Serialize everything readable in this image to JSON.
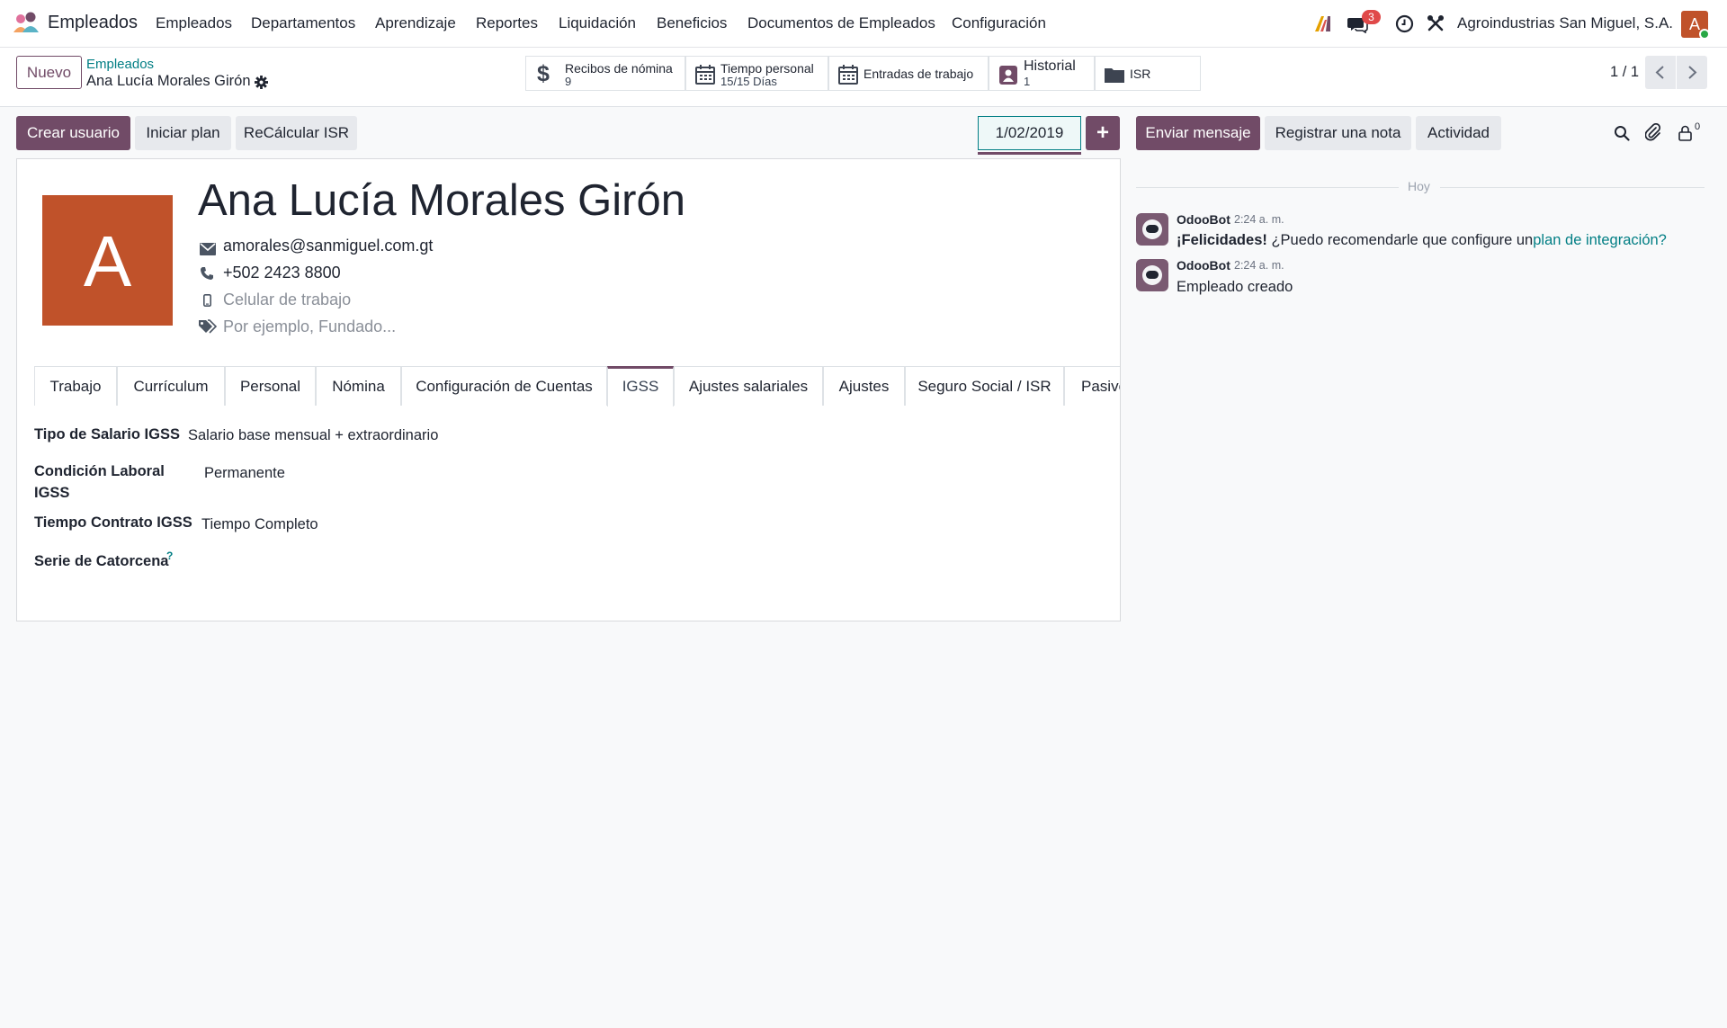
{
  "navbar": {
    "app_name": "Empleados",
    "menu": [
      "Empleados",
      "Departamentos",
      "Aprendizaje",
      "Reportes",
      "Liquidación",
      "Beneficios",
      "Documentos de Empleados",
      "Configuración"
    ],
    "messages_count": "3",
    "company": "Agroindustrias San Miguel, S.A.",
    "user_initial": "A"
  },
  "controlbar": {
    "new_button": "Nuevo",
    "breadcrumb_parent": "Empleados",
    "breadcrumb_current": "Ana Lucía Morales Girón",
    "pager": "1 / 1",
    "stats": [
      {
        "label": "Recibos de nómina",
        "value": "9"
      },
      {
        "label": "Tiempo personal",
        "value": "15/15 Días"
      },
      {
        "label": "Entradas de trabajo",
        "value": ""
      },
      {
        "label": "Historial",
        "value": "1"
      },
      {
        "label": "ISR",
        "value": ""
      }
    ]
  },
  "actions": {
    "create_user": "Crear usuario",
    "start_plan": "Iniciar plan",
    "recalc_isr": "ReCálcular ISR",
    "date": "1/02/2019",
    "add": "+"
  },
  "employee": {
    "avatar_letter": "A",
    "avatar_color": "#c0522a",
    "name": "Ana Lucía Morales Girón",
    "email": "amorales@sanmiguel.com.gt",
    "phone": "+502 2423 8800",
    "mobile_placeholder": "Celular de trabajo",
    "tags_placeholder": "Por ejemplo, Fundado..."
  },
  "tabs": [
    "Trabajo",
    "Currículum",
    "Personal",
    "Nómina",
    "Configuración de Cuentas",
    "IGSS",
    "Ajustes salariales",
    "Ajustes",
    "Seguro Social / ISR",
    "Pasivo"
  ],
  "active_tab": "IGSS",
  "igss": {
    "salary_type_label": "Tipo de Salario IGSS",
    "salary_type_value": "Salario base mensual + extraordinario",
    "labor_condition_label_1": "Condición Laboral",
    "labor_condition_label_2": "IGSS",
    "labor_condition_value": "Permanente",
    "contract_time_label": "Tiempo Contrato IGSS",
    "contract_time_value": "Tiempo Completo",
    "fortnight_series_label": "Serie de Catorcena",
    "help_mark": "?"
  },
  "chatter": {
    "send_message": "Enviar mensaje",
    "log_note": "Registrar una nota",
    "activity": "Actividad",
    "followers_count": "0",
    "date_separator": "Hoy",
    "messages": [
      {
        "author": "OdooBot",
        "time": "2:24 a. m.",
        "bold": "¡Felicidades!",
        "text": " ¿Puedo recomendarle que configure un",
        "link": "plan de integración?"
      },
      {
        "author": "OdooBot",
        "time": "2:24 a. m.",
        "bold": "",
        "text": "Empleado creado",
        "link": ""
      }
    ]
  },
  "colors": {
    "primary": "#714b67",
    "link": "#017e84",
    "badge": "#e04949"
  }
}
